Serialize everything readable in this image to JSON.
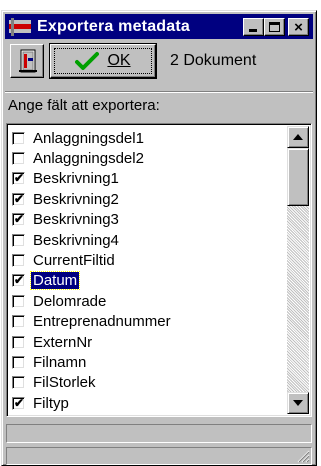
{
  "window": {
    "title": "Exportera metadata",
    "controls": {
      "minimize": "minimize",
      "maximize": "maximize",
      "close": "×"
    }
  },
  "toolbar": {
    "exit_icon": "exit-door-icon",
    "ok_label": "OK",
    "ok_icon": "checkmark-icon",
    "document_count": "2 Dokument"
  },
  "list": {
    "caption": "Ange fält att exportera:",
    "items": [
      {
        "label": "Anlaggningsdel1",
        "checked": false
      },
      {
        "label": "Anlaggningsdel2",
        "checked": false
      },
      {
        "label": "Beskrivning1",
        "checked": true
      },
      {
        "label": "Beskrivning2",
        "checked": true
      },
      {
        "label": "Beskrivning3",
        "checked": true
      },
      {
        "label": "Beskrivning4",
        "checked": false
      },
      {
        "label": "CurrentFiltid",
        "checked": false
      },
      {
        "label": "Datum",
        "checked": true,
        "selected": true
      },
      {
        "label": "Delomrade",
        "checked": false
      },
      {
        "label": "Entreprenadnummer",
        "checked": false
      },
      {
        "label": "ExternNr",
        "checked": false
      },
      {
        "label": "Filnamn",
        "checked": false
      },
      {
        "label": "FilStorlek",
        "checked": false
      },
      {
        "label": "Filtyp",
        "checked": true
      }
    ]
  },
  "colors": {
    "titlebar": "#000080",
    "face": "#c0c0c0",
    "selection": "#000080",
    "ok_check": "#00a000"
  }
}
